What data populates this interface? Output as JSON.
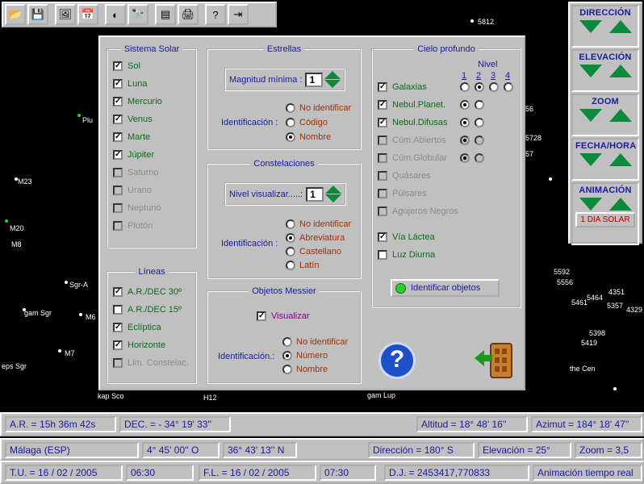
{
  "sky": {
    "labels": [
      "5812",
      "Plu",
      "M23",
      "M20",
      "M8",
      "Sgr-A",
      "gam Sgr",
      "M6",
      "M7",
      "eps Sgr",
      "kap Sco",
      "H12",
      "gam Lup",
      "5592",
      "5556",
      "4351",
      "5464",
      "5461",
      "5357",
      "4329",
      "5398",
      "5419",
      "the Cen",
      "5728",
      "56",
      "57"
    ]
  },
  "toolbar": {
    "buttons": [
      "open-icon",
      "save-icon",
      "image-icon",
      "calendar-icon",
      "moon-phase-icon",
      "binoculars-icon",
      "database-icon",
      "print-icon",
      "help-icon",
      "exit-icon"
    ],
    "button_symbols": [
      "📂",
      "💾",
      "🖼",
      "📅",
      "◐",
      "🔭",
      "▤",
      "🖨",
      "?",
      "⇥"
    ]
  },
  "right_panel": {
    "groups": [
      {
        "title": "DIRECCIÓN"
      },
      {
        "title": "ELEVACIÓN"
      },
      {
        "title": "ZOOM"
      },
      {
        "title": "FECHA/HORA"
      },
      {
        "title": "ANIMACIÓN"
      }
    ],
    "solar_button": "1 DIA SOLAR"
  },
  "dialog": {
    "solar_system": {
      "title": "Sistema Solar",
      "items": [
        {
          "label": "Sol",
          "checked": true,
          "enabled": true
        },
        {
          "label": "Luna",
          "checked": true,
          "enabled": true
        },
        {
          "label": "Mercurio",
          "checked": true,
          "enabled": true
        },
        {
          "label": "Venus",
          "checked": true,
          "enabled": true
        },
        {
          "label": "Marte",
          "checked": true,
          "enabled": true
        },
        {
          "label": "Júpiter",
          "checked": true,
          "enabled": true
        },
        {
          "label": "Saturno",
          "checked": false,
          "enabled": false
        },
        {
          "label": "Urano",
          "checked": false,
          "enabled": false
        },
        {
          "label": "Neptuno",
          "checked": false,
          "enabled": false
        },
        {
          "label": "Plutón",
          "checked": false,
          "enabled": false
        }
      ]
    },
    "lines": {
      "title": "Líneas",
      "items": [
        {
          "label": "A.R./DEC 30º",
          "checked": true,
          "enabled": true
        },
        {
          "label": "A.R./DEC 15º",
          "checked": false,
          "enabled": true
        },
        {
          "label": "Eclíptica",
          "checked": true,
          "enabled": true
        },
        {
          "label": "Horizonte",
          "checked": true,
          "enabled": true
        },
        {
          "label": "Lim. Constelac.",
          "checked": false,
          "enabled": false
        }
      ]
    },
    "stars": {
      "title": "Estrellas",
      "spin_label": "Magnitud mínima :",
      "spin_value": "1",
      "ident_label": "Identificación :",
      "options": [
        "No identificar",
        "Código",
        "Nombre"
      ],
      "selected": 2
    },
    "constellations": {
      "title": "Constelaciones",
      "spin_label": "Nivel visualizar.....:",
      "spin_value": "1",
      "ident_label": "Identificación :",
      "options": [
        "No identificar",
        "Abreviatura",
        "Castellano",
        "Latín"
      ],
      "selected": 1
    },
    "messier": {
      "title": "Objetos Messier",
      "visualize_label": "Visualizar",
      "visualize_checked": true,
      "ident_label": "Identificación.:",
      "options": [
        "No identificar",
        "Número",
        "Nombre"
      ],
      "selected": 1
    },
    "deep_sky": {
      "title": "Cielo profundo",
      "nivel_label": "Nivel",
      "levels": [
        "1",
        "2",
        "3",
        "4"
      ],
      "items": [
        {
          "label": "Galaxias",
          "checked": true,
          "enabled": true,
          "radios": 4,
          "selected": 1
        },
        {
          "label": "Nebul.Planet.",
          "checked": true,
          "enabled": true,
          "radios": 2,
          "selected": 0
        },
        {
          "label": "Nebul.Difusas",
          "checked": true,
          "enabled": true,
          "radios": 2,
          "selected": 0
        },
        {
          "label": "Cúm.Abiertos",
          "checked": false,
          "enabled": false,
          "radios": 2,
          "selected": 0
        },
        {
          "label": "Cúm.Globular",
          "checked": false,
          "enabled": false,
          "radios": 2,
          "selected": 0
        },
        {
          "label": "Quásares",
          "checked": false,
          "enabled": false,
          "radios": 0,
          "selected": -1
        },
        {
          "label": "Púlsares",
          "checked": false,
          "enabled": false,
          "radios": 0,
          "selected": -1
        },
        {
          "label": "Agujeros Negros",
          "checked": false,
          "enabled": false,
          "radios": 0,
          "selected": -1
        },
        {
          "label": "Vía Láctea",
          "checked": true,
          "enabled": true,
          "radios": 0,
          "selected": -1
        },
        {
          "label": "Luz Diurna",
          "checked": false,
          "enabled": true,
          "radios": 0,
          "selected": -1
        }
      ],
      "identify_button": "Identificar objetos"
    },
    "help_symbol": "?"
  },
  "status_row1": {
    "ra": "A.R. =  15h 36m 42s",
    "dec": "DEC. = - 34° 19' 33''",
    "altitude": "Altitud =  18° 48' 16''",
    "azimuth": "Azimut = 184° 18' 47''"
  },
  "status_row2": {
    "city": "Málaga         (ESP)",
    "longitude": "4° 45' 00'' O",
    "latitude": "36° 43' 13'' N",
    "direction": "Dirección = 180° S",
    "elevation": "Elevación = 25°",
    "zoom": "Zoom = 3,5"
  },
  "status_row3": {
    "tu": "T.U. = 16 / 02 /  2005",
    "tu_time": "06:30",
    "fl": "F.L. = 16 / 02 /  2005",
    "fl_time": "07:30",
    "jd": "D.J. = 2453417,770833",
    "animation": "Animación tiempo real"
  },
  "colors": {
    "accent": "#1a1aa0",
    "check_label": "#0a6a1a",
    "radio_label": "#a03000",
    "arrow_green": "#0a8a3a"
  }
}
